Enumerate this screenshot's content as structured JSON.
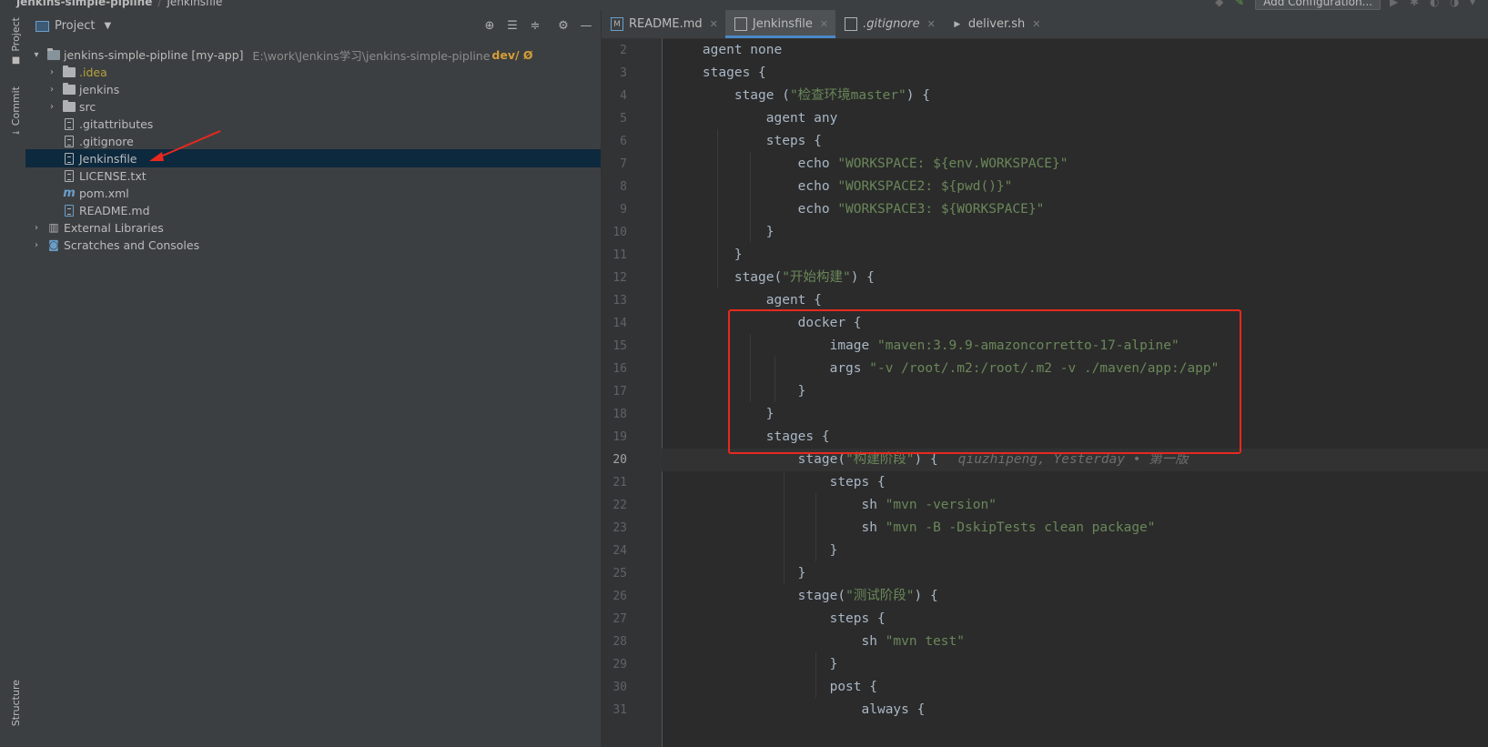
{
  "breadcrumb": {
    "project": "jenkins-simple-pipline",
    "file": "Jenkinsfile"
  },
  "toolbar": {
    "add_config_label": "Add Configuration..."
  },
  "left_strip": {
    "tabs": [
      "Project",
      "Commit",
      "Structure"
    ]
  },
  "project_panel": {
    "title": "Project",
    "tree": [
      {
        "label": "jenkins-simple-pipline [my-app]",
        "hint": "E:\\work\\Jenkins学习\\jenkins-simple-pipline",
        "branch": "dev/ Ø",
        "icon": "folder-icon",
        "expanded": true
      },
      {
        "label": ".idea",
        "icon": "folder-icon",
        "color": "#b8a23c"
      },
      {
        "label": "jenkins",
        "icon": "folder-icon"
      },
      {
        "label": "src",
        "icon": "folder-icon"
      },
      {
        "label": ".gitattributes",
        "icon": "file-icon"
      },
      {
        "label": ".gitignore",
        "icon": "git-file-icon"
      },
      {
        "label": "Jenkinsfile",
        "icon": "file-icon",
        "selected": true
      },
      {
        "label": "LICENSE.txt",
        "icon": "text-file-icon"
      },
      {
        "label": "pom.xml",
        "icon": "maven-icon"
      },
      {
        "label": "README.md",
        "icon": "markdown-icon"
      },
      {
        "label": "External Libraries",
        "icon": "library-icon"
      },
      {
        "label": "Scratches and Consoles",
        "icon": "scratch-icon"
      }
    ]
  },
  "editor": {
    "tabs": [
      {
        "label": "README.md",
        "icon": "markdown-icon"
      },
      {
        "label": "Jenkinsfile",
        "icon": "file-icon",
        "active": true
      },
      {
        "label": ".gitignore",
        "icon": "git-file-icon",
        "italic": true
      },
      {
        "label": "deliver.sh",
        "icon": "shell-icon"
      }
    ],
    "current_line": 20,
    "blame": "qiuzhipeng, Yesterday • 第一版",
    "lines": [
      {
        "n": "2",
        "t": "    agent none"
      },
      {
        "n": "3",
        "t": "    stages {"
      },
      {
        "n": "4",
        "t": "        stage (",
        "s": "\"检查环境master\"",
        "e": ") {"
      },
      {
        "n": "5",
        "t": "            agent any"
      },
      {
        "n": "6",
        "t": "            steps {"
      },
      {
        "n": "7",
        "t": "                echo ",
        "s": "\"WORKSPACE: ${env.WORKSPACE}\""
      },
      {
        "n": "8",
        "t": "                echo ",
        "s": "\"WORKSPACE2: ${pwd()}\""
      },
      {
        "n": "9",
        "t": "                echo ",
        "s": "\"WORKSPACE3: ${WORKSPACE}\""
      },
      {
        "n": "10",
        "t": "            }"
      },
      {
        "n": "11",
        "t": "        }"
      },
      {
        "n": "12",
        "t": "        stage(",
        "s": "\"开始构建\"",
        "e": ") {"
      },
      {
        "n": "13",
        "t": "            agent {"
      },
      {
        "n": "14",
        "t": "                docker {"
      },
      {
        "n": "15",
        "t": "                    image ",
        "s": "\"maven:3.9.9-amazoncorretto-17-alpine\""
      },
      {
        "n": "16",
        "t": "                    args ",
        "s": "\"-v /root/.m2:/root/.m2 -v ./maven/app:/app\""
      },
      {
        "n": "17",
        "t": "                }"
      },
      {
        "n": "18",
        "t": "            }"
      },
      {
        "n": "19",
        "t": "            stages {"
      },
      {
        "n": "20",
        "t": "                stage(",
        "s": "\"构建阶段\"",
        "e": ") {"
      },
      {
        "n": "21",
        "t": "                    steps {"
      },
      {
        "n": "22",
        "t": "                        sh ",
        "s": "\"mvn -version\""
      },
      {
        "n": "23",
        "t": "                        sh ",
        "s": "\"mvn -B -DskipTests clean package\""
      },
      {
        "n": "24",
        "t": "                    }"
      },
      {
        "n": "25",
        "t": "                }"
      },
      {
        "n": "26",
        "t": "                stage(",
        "s": "\"测试阶段\"",
        "e": ") {"
      },
      {
        "n": "27",
        "t": "                    steps {"
      },
      {
        "n": "28",
        "t": "                        sh ",
        "s": "\"mvn test\""
      },
      {
        "n": "29",
        "t": "                    }"
      },
      {
        "n": "30",
        "t": "                    post {"
      },
      {
        "n": "31",
        "t": "                        always {"
      }
    ]
  },
  "annotations": {
    "highlight_color": "#e8281e"
  }
}
